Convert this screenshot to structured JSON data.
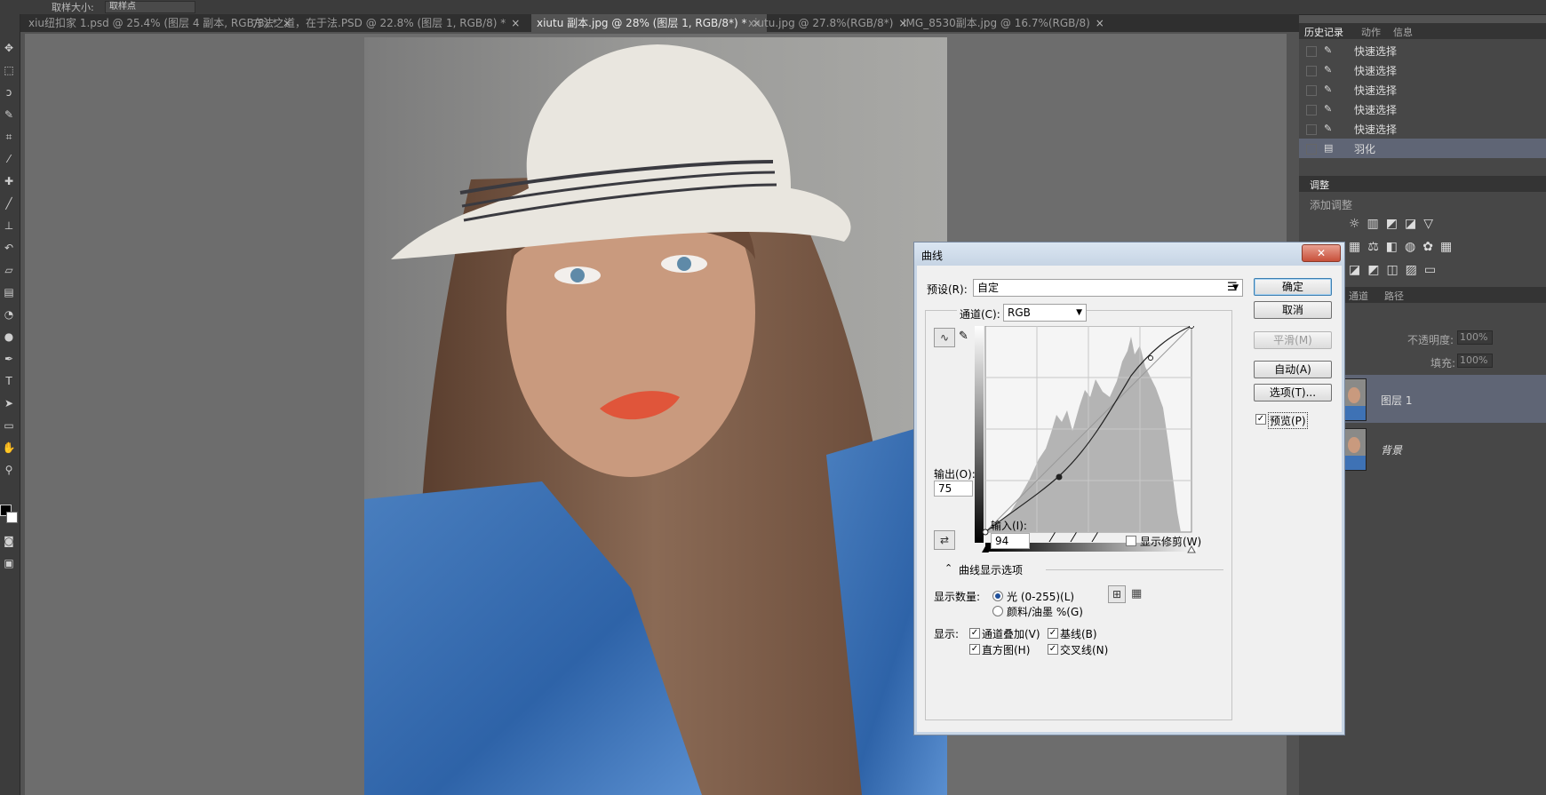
{
  "options_bar": {
    "label": "取样大小:",
    "value": "取样点"
  },
  "tabs": [
    {
      "label": "xiu纽扣家 1.psd @ 25.4% (图层 4 副本, RGB/8) *",
      "active": false
    },
    {
      "label": "方法之道，在于法.PSD @ 22.8% (图层 1, RGB/8) *",
      "active": false
    },
    {
      "label": "xiutu 副本.jpg @ 28% (图层 1, RGB/8*) *",
      "active": true
    },
    {
      "label": "xiutu.jpg @ 27.8%(RGB/8*)",
      "active": false
    },
    {
      "label": "IMG_8530副本.jpg @ 16.7%(RGB/8)",
      "active": false
    }
  ],
  "tab_close": "×",
  "tools": [
    "move-tool-icon",
    "marquee-tool-icon",
    "lasso-tool-icon",
    "quick-select-tool-icon",
    "crop-tool-icon",
    "eyedropper-tool-icon",
    "healing-brush-icon",
    "brush-tool-icon",
    "stamp-tool-icon",
    "history-brush-icon",
    "eraser-tool-icon",
    "gradient-tool-icon",
    "blur-tool-icon",
    "dodge-tool-icon",
    "pen-tool-icon",
    "type-tool-icon",
    "path-select-icon",
    "shape-tool-icon",
    "hand-tool-icon",
    "zoom-tool-icon"
  ],
  "panel": {
    "tabs": {
      "history": "历史记录",
      "actions": "动作",
      "info": "信息"
    },
    "history_items": [
      "快速选择",
      "快速选择",
      "快速选择",
      "快速选择",
      "快速选择",
      "羽化"
    ],
    "adjust_tab": "调整",
    "adjust_add": "添加调整",
    "layers_tabs": {
      "channels": "通道",
      "paths": "路径"
    },
    "opacity_label": "不透明度:",
    "opacity_value": "100%",
    "fill_label": "填充:",
    "fill_value": "100%",
    "layers": [
      {
        "name": "图层 1",
        "selected": true
      },
      {
        "name": "背景",
        "selected": false
      }
    ]
  },
  "curves": {
    "title": "曲线",
    "close": "✕",
    "preset_label": "预设(R):",
    "preset_value": "自定",
    "channel_label": "通道(C):",
    "channel_value": "RGB",
    "output_label": "输出(O):",
    "output_value": "75",
    "input_label": "输入(I):",
    "input_value": "94",
    "show_clipping": "显示修剪(W)",
    "ok": "确定",
    "cancel": "取消",
    "smooth": "平滑(M)",
    "auto": "自动(A)",
    "options": "选项(T)...",
    "preview": "预览(P)",
    "display_options": "曲线显示选项",
    "show_amount_label": "显示数量:",
    "light_option": "光 (0-255)(L)",
    "pigment_option": "颜料/油墨 %(G)",
    "show_label": "显示:",
    "channel_overlay": "通道叠加(V)",
    "baseline": "基线(B)",
    "histogram": "直方图(H)",
    "intersection": "交叉线(N)",
    "check": "✓",
    "colors": {
      "accent": "#3c7fb1",
      "histogram": "#b4b4b4",
      "close": "#c7503a"
    }
  }
}
